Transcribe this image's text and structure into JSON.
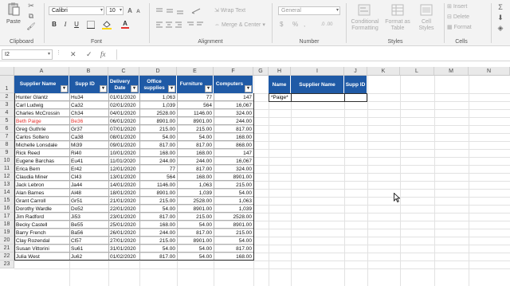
{
  "ribbon": {
    "clipboard": {
      "paste": "Paste",
      "label": "Clipboard"
    },
    "font": {
      "name": "Calibri",
      "size": "10",
      "bold": "B",
      "italic": "I",
      "underline": "U",
      "grow": "A",
      "shrink": "A",
      "font_color": "A",
      "label": "Font"
    },
    "alignment": {
      "wrap_text": "Wrap Text",
      "merge_center": "Merge & Center",
      "label": "Alignment"
    },
    "number": {
      "format": "General",
      "currency": "$",
      "percent": "%",
      "comma": ",",
      "label": "Number"
    },
    "styles": {
      "conditional": "Conditional",
      "conditional2": "Formatting",
      "format_table": "Format as",
      "format_table2": "Table",
      "cell_styles": "Cell",
      "cell_styles2": "Styles",
      "label": "Styles"
    },
    "cells": {
      "insert": "Insert",
      "delete": "Delete",
      "format": "Format",
      "label": "Cells"
    }
  },
  "formula_bar": {
    "name_box": "I2",
    "cancel": "✕",
    "enter": "✓",
    "fx": "fx",
    "value": ""
  },
  "columns": [
    "A",
    "B",
    "C",
    "D",
    "E",
    "F",
    "G",
    "H",
    "I",
    "J",
    "K",
    "L",
    "M",
    "N"
  ],
  "rows": [
    "1",
    "2",
    "3",
    "4",
    "5",
    "6",
    "7",
    "8",
    "9",
    "10",
    "11",
    "12",
    "13",
    "14",
    "15",
    "16",
    "17",
    "18",
    "19",
    "20",
    "21",
    "22",
    "23"
  ],
  "table": {
    "headers": [
      {
        "line1": "Supplier Name",
        "line2": ""
      },
      {
        "line1": "Supp ID",
        "line2": ""
      },
      {
        "line1": "Delivery",
        "line2": "Date"
      },
      {
        "line1": "Office",
        "line2": "supplies"
      },
      {
        "line1": "Furniture",
        "line2": ""
      },
      {
        "line1": "Computers",
        "line2": ""
      }
    ],
    "filter_glyph": "▾",
    "rows": [
      [
        "Hunter Glantz",
        "Hu34",
        "01/01/2020",
        "1,063",
        "77",
        "147"
      ],
      [
        "Carl Ludwig",
        "Ca32",
        "02/01/2020",
        "1,039",
        "564",
        "16,067"
      ],
      [
        "Charles McCrossin",
        "Ch34",
        "04/01/2020",
        "2528.00",
        "1146.00",
        "324.00"
      ],
      [
        "Beth Paige",
        "Be36",
        "06/01/2020",
        "8901.00",
        "8901.00",
        "244.00"
      ],
      [
        "Greg Guthrie",
        "Gr37",
        "07/01/2020",
        "215.00",
        "215.00",
        "817.00"
      ],
      [
        "Carlos Soltero",
        "Ca38",
        "08/01/2020",
        "54.00",
        "54.00",
        "168.00"
      ],
      [
        "Michelle Lonsdale",
        "Mi39",
        "09/01/2020",
        "817.00",
        "817.00",
        "868.00"
      ],
      [
        "Rick Reed",
        "Ri40",
        "10/01/2020",
        "168.00",
        "168.00",
        "147"
      ],
      [
        "Eugene Barchas",
        "Eu41",
        "11/01/2020",
        "244.00",
        "244.00",
        "16,067"
      ],
      [
        "Erica Bern",
        "Er42",
        "12/01/2020",
        "77",
        "817.00",
        "324.00"
      ],
      [
        "Claudia Miner",
        "Cl43",
        "13/01/2020",
        "564",
        "168.00",
        "8901.00"
      ],
      [
        "Jack Lebron",
        "Ja44",
        "14/01/2020",
        "1146.00",
        "1,063",
        "215.00"
      ],
      [
        "Alan Barnes",
        "Al48",
        "18/01/2020",
        "8901.00",
        "1,039",
        "54.00"
      ],
      [
        "Grant Carroll",
        "Gr51",
        "21/01/2020",
        "215.00",
        "2528.00",
        "1,063"
      ],
      [
        "Dorothy Wardle",
        "Do52",
        "22/01/2020",
        "54.00",
        "8901.00",
        "1,039"
      ],
      [
        "Jim Radford",
        "Ji53",
        "23/01/2020",
        "817.00",
        "215.00",
        "2528.00"
      ],
      [
        "Becky Castell",
        "Be55",
        "25/01/2020",
        "168.00",
        "54.00",
        "8901.00"
      ],
      [
        "Barry French",
        "Ba56",
        "26/01/2020",
        "244.00",
        "817.00",
        "215.00"
      ],
      [
        "Clay Rozendal",
        "Cl57",
        "27/01/2020",
        "215.00",
        "8901.00",
        "54.00"
      ],
      [
        "Susan Vittorini",
        "Su61",
        "31/01/2020",
        "54.00",
        "54.00",
        "817.00"
      ],
      [
        "Julia West",
        "Ju62",
        "01/02/2020",
        "817.00",
        "54.00",
        "168.00"
      ]
    ],
    "highlight_color": "#e5322d"
  },
  "criteria": {
    "headers": [
      "Name",
      "Supplier Name",
      "Supp ID"
    ],
    "value": "*Paige*"
  },
  "colors": {
    "header_bg": "#1f5aa6",
    "header_text": "#ffffff"
  }
}
